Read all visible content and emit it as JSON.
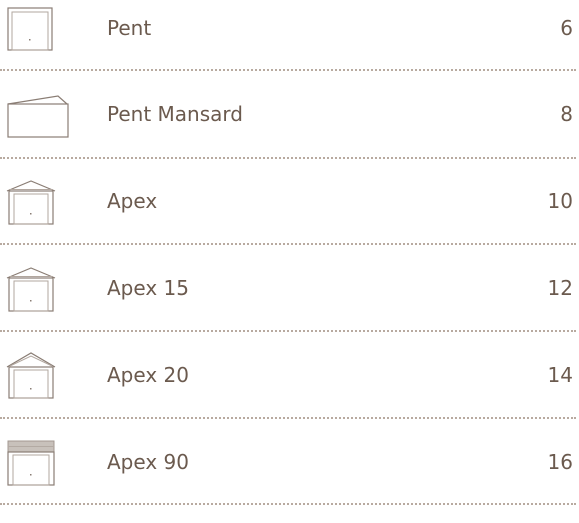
{
  "contents": {
    "items": [
      {
        "label": "Pent",
        "page": "6",
        "icon": "pent-shed-icon"
      },
      {
        "label": "Pent Mansard",
        "page": "8",
        "icon": "pent-mansard-shed-icon"
      },
      {
        "label": "Apex",
        "page": "10",
        "icon": "apex-shed-icon"
      },
      {
        "label": "Apex 15",
        "page": "12",
        "icon": "apex-15-shed-icon"
      },
      {
        "label": "Apex 20",
        "page": "14",
        "icon": "apex-20-shed-icon"
      },
      {
        "label": "Apex 90",
        "page": "16",
        "icon": "apex-90-shed-icon"
      }
    ]
  },
  "colors": {
    "text": "#6b5a4e",
    "separator": "#b8aaa0",
    "icon_stroke": "#8a7d74"
  }
}
